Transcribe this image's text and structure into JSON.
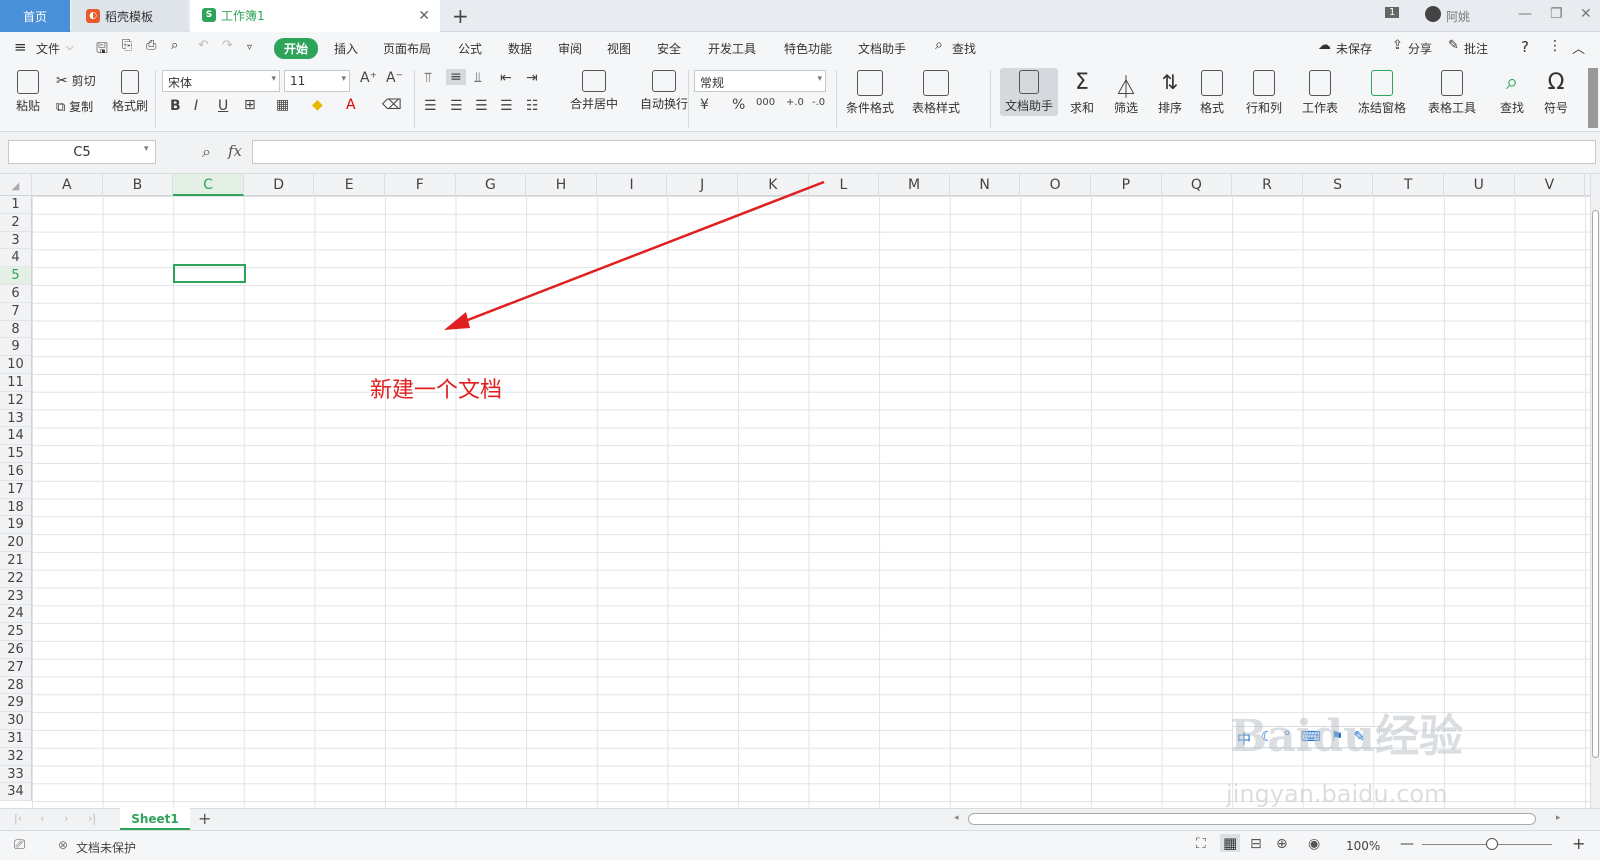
{
  "tabs": {
    "home": "首页",
    "template": "稻壳模板",
    "workbook": "工作簿1",
    "new_tab": "+",
    "close": "✕"
  },
  "titlebar": {
    "window_count": "1",
    "user": "阿姚"
  },
  "menu": {
    "file": "文件",
    "start": "开始",
    "insert": "插入",
    "page_layout": "页面布局",
    "formula": "公式",
    "data": "数据",
    "review": "审阅",
    "view": "视图",
    "security": "安全",
    "dev_tools": "开发工具",
    "features": "特色功能",
    "doc_helper": "文档助手",
    "search": "查找",
    "unsaved": "未保存",
    "share": "分享",
    "comment": "批注",
    "help": "?"
  },
  "ribbon": {
    "paste": "粘贴",
    "cut": "剪切",
    "copy": "复制",
    "format_painter": "格式刷",
    "font_name": "宋体",
    "font_size": "11",
    "merge_center": "合并居中",
    "wrap_text": "自动换行",
    "number_format": "常规",
    "conditional_format": "条件格式",
    "table_style": "表格样式",
    "doc_helper": "文档助手",
    "sum": "求和",
    "filter": "筛选",
    "sort": "排序",
    "format": "格式",
    "row_col": "行和列",
    "worksheet": "工作表",
    "freeze": "冻结窗格",
    "table_tools": "表格工具",
    "find": "查找",
    "symbol": "符号",
    "bold": "B",
    "italic": "I",
    "underline": "U",
    "increase_font": "A⁺",
    "decrease_font": "A⁻",
    "percent": "%",
    "thousands": "000",
    "dec_inc": "+.0",
    "dec_dec": "-.0"
  },
  "formula_bar": {
    "cell_ref": "C5",
    "fx": "fx",
    "content": ""
  },
  "grid": {
    "columns": [
      "A",
      "B",
      "C",
      "D",
      "E",
      "F",
      "G",
      "H",
      "I",
      "J",
      "K",
      "L",
      "M",
      "N",
      "O",
      "P",
      "Q",
      "R",
      "S",
      "T",
      "U",
      "V"
    ],
    "rows": [
      "1",
      "2",
      "3",
      "4",
      "5",
      "6",
      "7",
      "8",
      "9",
      "10",
      "11",
      "12",
      "13",
      "14",
      "15",
      "16",
      "17",
      "18",
      "19",
      "20",
      "21",
      "22",
      "23",
      "24",
      "25",
      "26",
      "27",
      "28",
      "29",
      "30",
      "31",
      "32",
      "33",
      "34"
    ],
    "selected_col": "C",
    "selected_row": "5"
  },
  "annotation": "新建一个文档",
  "sheetbar": {
    "sheet1": "Sheet1",
    "add": "+"
  },
  "statusbar": {
    "protection": "文档未保护",
    "zoom": "100%",
    "zoom_out": "—",
    "zoom_in": "+"
  },
  "watermark": {
    "main": "Baidu经验",
    "sub": "jingyan.baidu.com",
    "ime": "中"
  },
  "colors": {
    "accent": "#2ea35a",
    "home_tab": "#4a90d9",
    "annotation": "#e02020"
  }
}
